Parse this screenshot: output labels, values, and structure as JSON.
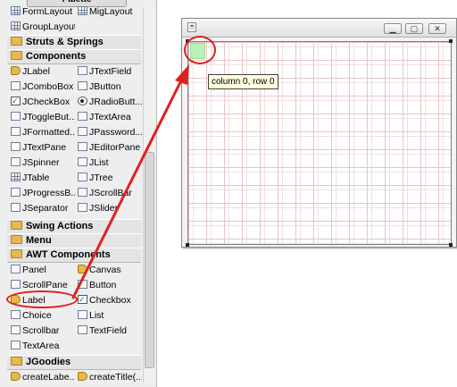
{
  "palette": {
    "title": "Palette",
    "top_items": [
      {
        "label": "FormLayout",
        "icon": "grid-layout-icon"
      },
      {
        "label": "MigLayout",
        "icon": "grid-layout-icon"
      },
      {
        "label": "GroupLayout",
        "icon": "grid-layout-icon"
      }
    ],
    "categories": {
      "struts": "Struts & Springs",
      "components": "Components",
      "swing_actions": "Swing Actions",
      "menu": "Menu",
      "awt": "AWT Components",
      "jgoodies": "JGoodies"
    },
    "components": [
      "JLabel",
      "JTextField",
      "JComboBox",
      "JButton",
      "JCheckBox",
      "JRadioButt...",
      "JToggleBut...",
      "JTextArea",
      "JFormatted...",
      "JPassword...",
      "JTextPane",
      "JEditorPane",
      "JSpinner",
      "JList",
      "JTable",
      "JTree",
      "JProgressB...",
      "JScrollBar",
      "JSeparator",
      "JSlider"
    ],
    "awt": [
      "Panel",
      "Canvas",
      "ScrollPane",
      "Button",
      "Label",
      "Checkbox",
      "Choice",
      "List",
      "Scrollbar",
      "TextField",
      "TextArea"
    ],
    "jgoodies": [
      "createLabe...",
      "createTitle(..."
    ]
  },
  "form": {
    "tooltip": "column 0, row 0"
  },
  "colors": {
    "annotation": "#e02020",
    "selected_cell": "#b9f2b9",
    "grid_line": "#e7c4c4"
  }
}
